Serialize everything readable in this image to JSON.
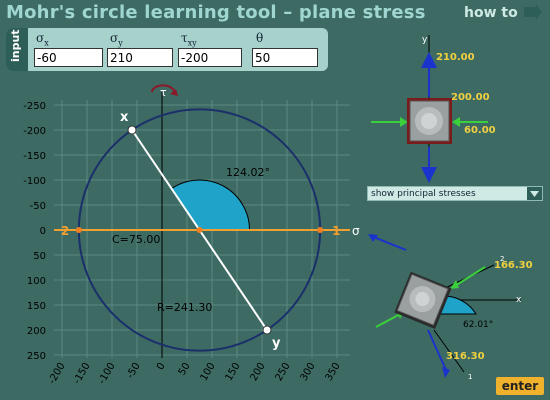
{
  "app": {
    "title": "Mohr's circle learning tool – plane stress",
    "howto": "how to",
    "enter": "enter"
  },
  "inputs": {
    "section_label": "input",
    "sigma_x": {
      "label": "σ",
      "sub": "x",
      "value": "-60"
    },
    "sigma_y": {
      "label": "σ",
      "sub": "y",
      "value": "210"
    },
    "tau_xy": {
      "label": "τ",
      "sub": "xy",
      "value": "-200"
    },
    "theta": {
      "label": "θ",
      "value": "50"
    }
  },
  "dropdown": {
    "selected": "show principal stresses"
  },
  "mohr": {
    "center": 75,
    "radius": 241.3,
    "center_label": "C=75.00",
    "radius_label": "R=241.30",
    "angle_label": "124.02°",
    "point_x": {
      "label": "x",
      "sigma": -60,
      "tau": -200
    },
    "point_y": {
      "label": "y",
      "sigma": 210,
      "tau": 200
    },
    "principal_1": {
      "label": "1",
      "sigma": 316.3
    },
    "principal_2": {
      "label": "2",
      "sigma": -166.3
    },
    "sigma_axis_label": "σ",
    "tau_axis_label": "τ",
    "x_ticks": [
      "-200",
      "-150",
      "-100",
      "-50",
      "0",
      "50",
      "100",
      "150",
      "200",
      "250",
      "300",
      "350"
    ],
    "y_ticks": [
      "-250",
      "-200",
      "-150",
      "-100",
      "-50",
      "0",
      "50",
      "100",
      "150",
      "200",
      "250"
    ]
  },
  "element_top": {
    "axis_label": "y",
    "sigma_y": "210.00",
    "tau_xy": "200.00",
    "sigma_x": "60.00",
    "colors": {
      "normal": "#1a33cc",
      "compress": "#3ccf3c",
      "shear": "#7a1a1a"
    }
  },
  "element_bottom": {
    "axis_x": "x",
    "label_2": "2",
    "label_1": "1",
    "sigma_2": "166.30",
    "sigma_1": "316.30",
    "angle": "62.01°"
  },
  "colors": {
    "background": "#3d6b64",
    "circle": "#1b2f6b",
    "principal_line": "#f0a030",
    "wedge": "#1fa3c9",
    "label_gold": "#f0d040"
  }
}
